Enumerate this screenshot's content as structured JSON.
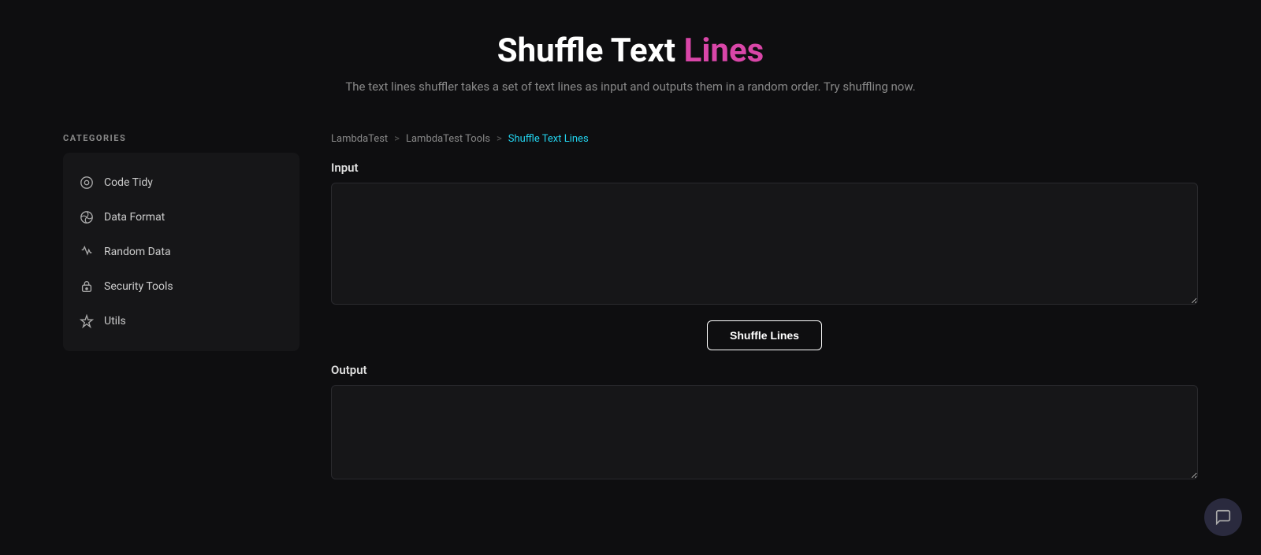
{
  "header": {
    "title_plain": "Shuffle Text",
    "title_highlight": "Lines",
    "subtitle": "The text lines shuffler takes a set of text lines as input and outputs them in a random order. Try shuffling now."
  },
  "breadcrumb": {
    "items": [
      {
        "label": "LambdaTest",
        "link": true
      },
      {
        "label": "LambdaTest Tools",
        "link": true
      },
      {
        "label": "Shuffle Text Lines",
        "current": true
      }
    ],
    "separator": ">"
  },
  "categories": {
    "label": "CATEGORIES",
    "items": [
      {
        "id": "code-tidy",
        "label": "Code Tidy",
        "icon": "code-tidy-icon"
      },
      {
        "id": "data-format",
        "label": "Data Format",
        "icon": "data-format-icon"
      },
      {
        "id": "random-data",
        "label": "Random Data",
        "icon": "random-data-icon"
      },
      {
        "id": "security-tools",
        "label": "Security Tools",
        "icon": "security-tools-icon"
      },
      {
        "id": "utils",
        "label": "Utils",
        "icon": "utils-icon"
      }
    ]
  },
  "input_section": {
    "label": "Input",
    "placeholder": ""
  },
  "button": {
    "label": "Shuffle Lines"
  },
  "output_section": {
    "label": "Output",
    "placeholder": ""
  },
  "colors": {
    "highlight": "#d946a8",
    "breadcrumb_current": "#22d3ee",
    "background": "#0e0e10",
    "card_bg": "#161618"
  }
}
